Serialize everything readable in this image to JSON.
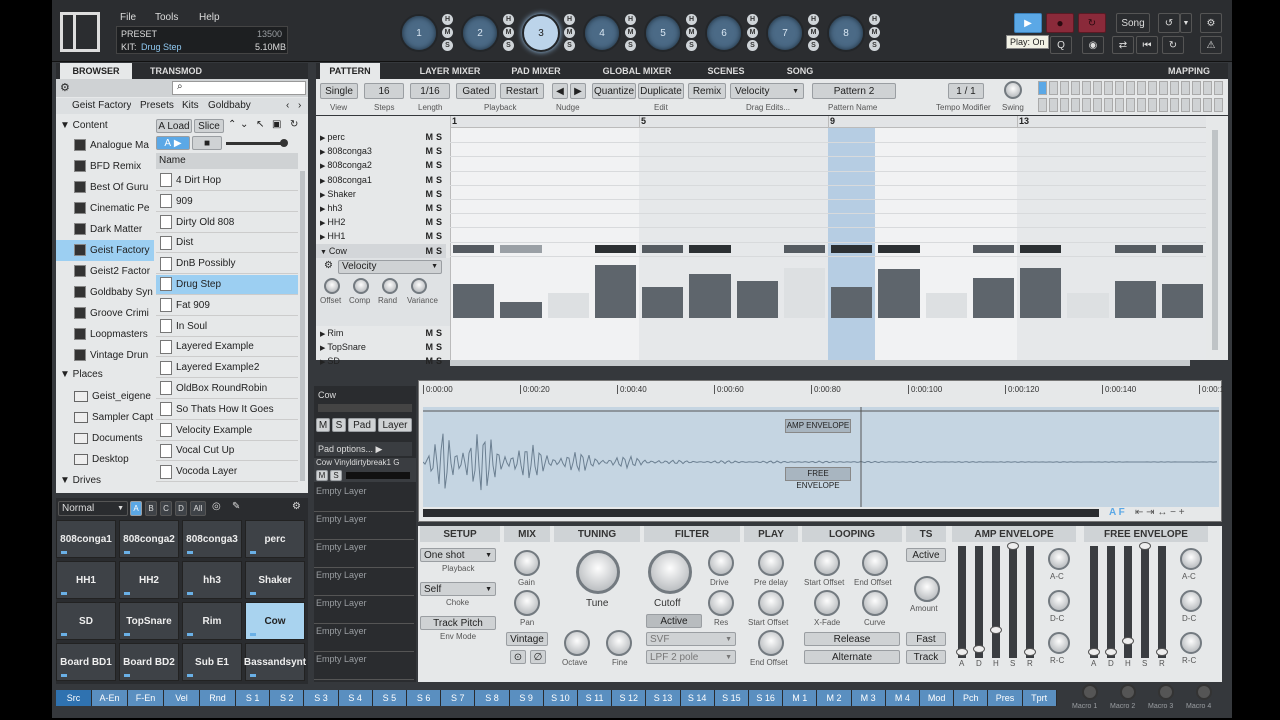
{
  "menu": {
    "file": "File",
    "tools": "Tools",
    "help": "Help"
  },
  "preset": {
    "label": "PRESET",
    "kit_prefix": "KIT:",
    "kit_name": "Drug Step",
    "counter": "13500",
    "memory": "5.10MB"
  },
  "pads_top": [
    "1",
    "2",
    "3",
    "4",
    "5",
    "6",
    "7",
    "8"
  ],
  "pads_top_selected": 2,
  "transport": {
    "song_label": "Song",
    "play_tooltip": "Play: On"
  },
  "left_tabs": [
    "BROWSER",
    "TRANSMOD"
  ],
  "breadcrumb": [
    "Geist Factory",
    "Presets",
    "Kits",
    "Goldbaby"
  ],
  "tree": {
    "content_label": "Content",
    "items": [
      "Analogue Ma",
      "BFD Remix",
      "Best Of Guru",
      "Cinematic Pe",
      "Dark Matter",
      "Geist Factory",
      "Geist2 Factor",
      "Goldbaby Syn",
      "Groove Crimi",
      "Loopmasters",
      "Vintage Drun"
    ],
    "selected_index": 5,
    "places_label": "Places",
    "places": [
      "Geist_eigene",
      "Sampler Capt",
      "Documents",
      "Desktop"
    ],
    "drives_label": "Drives"
  },
  "filelist": {
    "load_label": "A Load",
    "slice_label": "Slice",
    "a_label": "A",
    "name_header": "Name",
    "items": [
      "4 Dirt Hop",
      "909",
      "Dirty Old 808",
      "Dist",
      "DnB Possibly",
      "Drug Step",
      "Fat 909",
      "In Soul",
      "Layered Example",
      "Layered Example2",
      "OldBox RoundRobin",
      "So Thats How It Goes",
      "Velocity Example",
      "Vocal Cut Up",
      "Vocoda Layer"
    ],
    "selected_index": 5
  },
  "pad_grid": {
    "mode": "Normal",
    "banks": [
      "A",
      "B",
      "C",
      "D",
      "All"
    ],
    "pads": [
      "808conga1",
      "808conga2",
      "808conga3",
      "perc",
      "HH1",
      "HH2",
      "hh3",
      "Shaker",
      "SD",
      "TopSnare",
      "Rim",
      "Cow",
      "Board BD1",
      "Board BD2",
      "Sub E1",
      "Bassandsynt"
    ],
    "selected_index": 11
  },
  "main_tabs": [
    "PATTERN",
    "LAYER MIXER",
    "PAD MIXER",
    "GLOBAL MIXER",
    "SCENES",
    "SONG"
  ],
  "mapping_label": "MAPPING",
  "pattern_toolbar": {
    "single": "Single",
    "view": "View",
    "steps_value": "16",
    "steps_label": "Steps",
    "length_value": "1/16",
    "length_label": "Length",
    "gated": "Gated",
    "restart": "Restart",
    "playback_label": "Playback",
    "nudge_label": "Nudge",
    "quantize": "Quantize",
    "duplicate": "Duplicate",
    "remix": "Remix",
    "edit_label": "Edit",
    "drag_value": "Velocity",
    "drag_label": "Drag Edits...",
    "pattern_name": "Pattern 2",
    "pattern_name_label": "Pattern Name",
    "tempo_value": "1 / 1",
    "tempo_label": "Tempo Modifier",
    "swing_label": "Swing"
  },
  "ruler": [
    "1",
    "5",
    "9",
    "13"
  ],
  "tracks": [
    "perc",
    "808conga3",
    "808conga2",
    "808conga1",
    "Shaker",
    "hh3",
    "HH2",
    "HH1",
    "Cow"
  ],
  "tracks_below": [
    "Rim",
    "TopSnare",
    "SD"
  ],
  "ms": {
    "m": "M",
    "s": "S"
  },
  "velocity_lane": {
    "dropdown": "Velocity",
    "knobs": [
      "Offset",
      "Comp",
      "Rand",
      "Variance"
    ],
    "values": [
      0.55,
      0.25,
      0.4,
      0.85,
      0.5,
      0.7,
      0.6,
      0.8,
      0.5,
      0.78,
      0.4,
      0.65,
      0.8,
      0.4,
      0.6,
      0.55
    ]
  },
  "layer_panel": {
    "pad_name": "Cow",
    "m": "M",
    "s": "S",
    "pad": "Pad",
    "layer": "Layer",
    "pad_options": "Pad options...",
    "sample": "Cow Vinyldirtybreak1 G",
    "empty_label": "Empty Layer"
  },
  "waveform": {
    "times": [
      "0:00:00",
      "0:00:20",
      "0:00:40",
      "0:00:60",
      "0:00:80",
      "0:00:100",
      "0:00:120",
      "0:00:140",
      "0:00:1"
    ],
    "amp_env": "AMP ENVELOPE",
    "free_env": "FREE ENVELOPE",
    "af": "A F"
  },
  "sections": {
    "setup": "SETUP",
    "mix": "MIX",
    "tuning": "TUNING",
    "filter": "FILTER",
    "play": "PLAY",
    "looping": "LOOPING",
    "ts": "TS",
    "amp": "AMP ENVELOPE",
    "free": "FREE ENVELOPE"
  },
  "setup": {
    "oneshot": "One shot",
    "playback": "Playback",
    "self": "Self",
    "choke": "Choke",
    "trackpitch": "Track Pitch",
    "envmode": "Env Mode"
  },
  "mix": {
    "gain": "Gain",
    "pan": "Pan",
    "vintage": "Vintage"
  },
  "tuning": {
    "tune": "Tune",
    "octave": "Octave",
    "fine": "Fine"
  },
  "filter": {
    "cutoff": "Cutoff",
    "drive": "Drive",
    "res": "Res",
    "active": "Active",
    "type": "SVF",
    "pole": "LPF 2 pole"
  },
  "play": {
    "predelay": "Pre delay",
    "startoffset": "Start Offset",
    "endoffset": "End Offset"
  },
  "looping": {
    "startoffset": "Start Offset",
    "endoffset": "End Offset",
    "xfade": "X-Fade",
    "curve": "Curve",
    "release": "Release",
    "alternate": "Alternate"
  },
  "ts": {
    "active": "Active",
    "amount": "Amount",
    "fast": "Fast",
    "track": "Track"
  },
  "env_labels": [
    "A",
    "D",
    "H",
    "S",
    "R"
  ],
  "env_knobs": [
    "A-C",
    "D-C",
    "R-C"
  ],
  "bottom_tabs": [
    "Src",
    "A-En",
    "F-En",
    "Vel",
    "Rnd",
    "S 1",
    "S 2",
    "S 3",
    "S 4",
    "S 5",
    "S 6",
    "S 7",
    "S 8",
    "S 9",
    "S 10",
    "S 11",
    "S 12",
    "S 13",
    "S 14",
    "S 15",
    "S 16",
    "M 1",
    "M 2",
    "M 3",
    "M 4",
    "Mod",
    "Pch",
    "Pres",
    "Tprt"
  ],
  "macros": [
    "Macro 1",
    "Macro 2",
    "Macro 3",
    "Macro 4"
  ]
}
